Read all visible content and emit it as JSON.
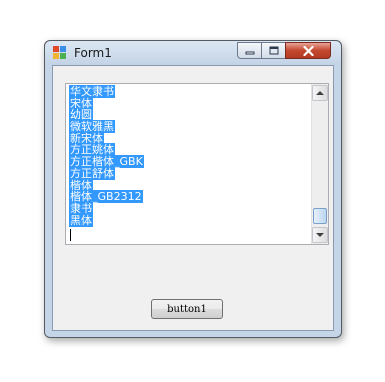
{
  "window": {
    "title": "Form1"
  },
  "titlebar": {
    "icon": "app-form-icon",
    "buttons": [
      "minimize-icon",
      "maximize-icon",
      "close-icon"
    ]
  },
  "listbox": {
    "items": [
      "华文隶书",
      "宋体",
      "幼圆",
      "微软雅黑",
      "新宋体",
      "方正姚体",
      "方正楷体_GBK",
      "方正舒体",
      "楷体",
      "楷体_GB2312",
      "隶书",
      "黑体"
    ],
    "selection_color": "#3399ff"
  },
  "button1": {
    "label": "button1"
  },
  "colors": {
    "client_background": "#f0f0f0",
    "frame": "#c5d5e8",
    "close_button": "#c4472f"
  }
}
